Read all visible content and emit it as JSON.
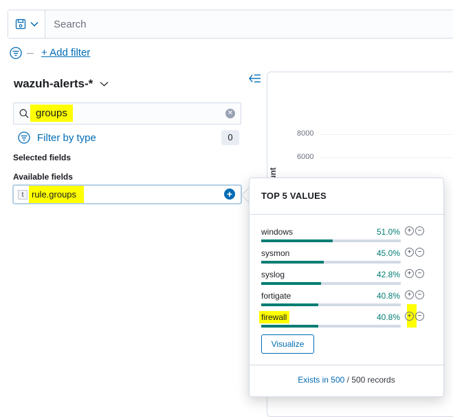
{
  "querybar": {
    "search_placeholder": "Search"
  },
  "filters": {
    "add_filter_label": "+ Add filter"
  },
  "sidebar": {
    "index_pattern": "wazuh-alerts-*",
    "field_search_value": "groups",
    "filter_by_type_label": "Filter by type",
    "filter_count": "0",
    "selected_fields_heading": "Selected fields",
    "available_fields_heading": "Available fields",
    "fields": [
      {
        "type": "t",
        "name": "rule.groups"
      }
    ]
  },
  "chart": {
    "y_ticks": [
      "8000",
      "6000"
    ],
    "y_label_partial": "unt"
  },
  "popover": {
    "title": "TOP 5 VALUES",
    "values": [
      {
        "name": "windows",
        "percent_label": "51.0%",
        "percent": 51.0
      },
      {
        "name": "sysmon",
        "percent_label": "45.0%",
        "percent": 45.0
      },
      {
        "name": "syslog",
        "percent_label": "42.8%",
        "percent": 42.8
      },
      {
        "name": "fortigate",
        "percent_label": "40.8%",
        "percent": 40.8
      },
      {
        "name": "firewall",
        "percent_label": "40.8%",
        "percent": 40.8
      }
    ],
    "visualize_label": "Visualize",
    "footer_link": "Exists in 500",
    "footer_rest": " / 500 records"
  },
  "colors": {
    "accent": "#006bb4",
    "bar": "#017d73",
    "highlight": "#ffff00"
  }
}
